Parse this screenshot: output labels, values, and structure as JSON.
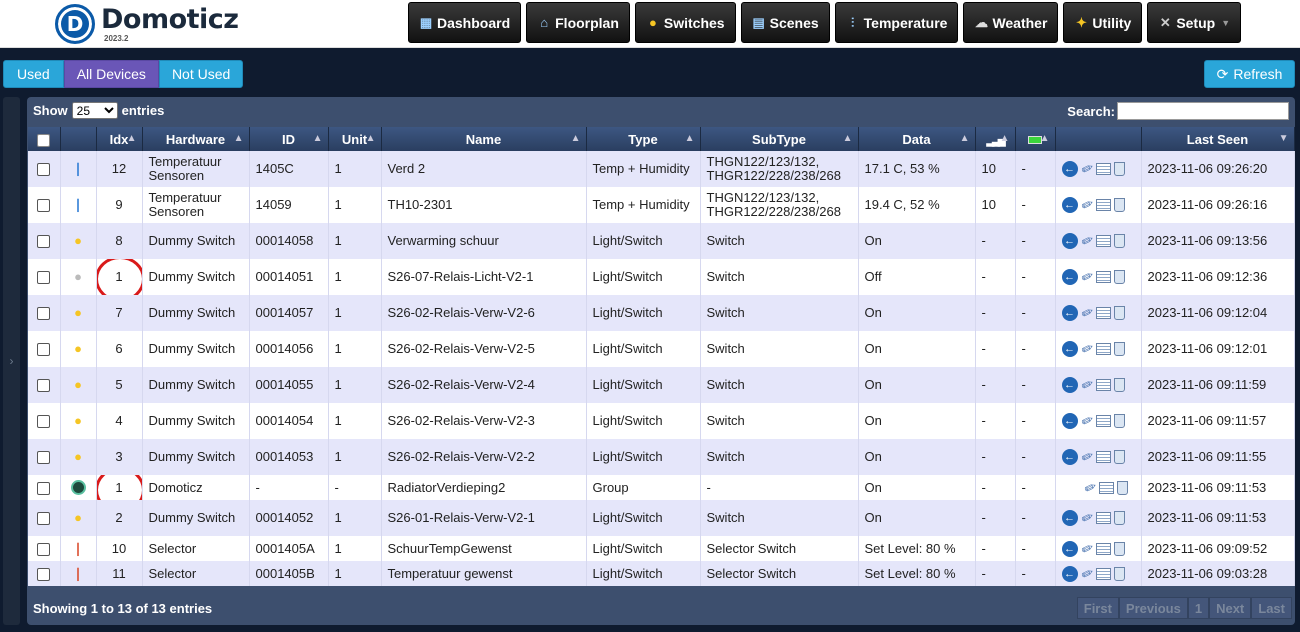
{
  "app": {
    "name": "Domoticz",
    "version": "2023.2"
  },
  "nav": [
    {
      "label": "Dashboard",
      "icon": "dashboard-icon"
    },
    {
      "label": "Floorplan",
      "icon": "floorplan-icon"
    },
    {
      "label": "Switches",
      "icon": "bulb-icon"
    },
    {
      "label": "Scenes",
      "icon": "scenes-icon"
    },
    {
      "label": "Temperature",
      "icon": "thermometer-icon"
    },
    {
      "label": "Weather",
      "icon": "weather-icon"
    },
    {
      "label": "Utility",
      "icon": "utility-icon"
    },
    {
      "label": "Setup",
      "icon": "wrench-icon"
    }
  ],
  "filter": {
    "used": "Used",
    "all": "All Devices",
    "not_used": "Not Used",
    "active": "All Devices"
  },
  "refresh_label": "Refresh",
  "table_ctrl": {
    "show": "Show",
    "page_size": "25",
    "entries": "entries",
    "search": "Search:"
  },
  "columns": {
    "idx": "Idx",
    "hardware": "Hardware",
    "id": "ID",
    "unit": "Unit",
    "name": "Name",
    "type": "Type",
    "subtype": "SubType",
    "data": "Data",
    "last_seen": "Last Seen"
  },
  "rows": [
    {
      "icon": "thermometer",
      "idx": "12",
      "hardware": "Temperatuur Sensoren",
      "id": "1405C",
      "unit": "1",
      "name": "Verd 2",
      "type": "Temp + Humidity",
      "subtype": "THGN122/123/132, THGR122/228/238/268",
      "data": "17.1 C, 53 %",
      "signal": "10",
      "battery": "-",
      "last_seen": "2023-11-06 09:26:20"
    },
    {
      "icon": "thermometer",
      "idx": "9",
      "hardware": "Temperatuur Sensoren",
      "id": "14059",
      "unit": "1",
      "name": "TH10-2301",
      "type": "Temp + Humidity",
      "subtype": "THGN122/123/132, THGR122/228/238/268",
      "data": "19.4 C, 52 %",
      "signal": "10",
      "battery": "-",
      "last_seen": "2023-11-06 09:26:16"
    },
    {
      "icon": "bulb",
      "idx": "8",
      "hardware": "Dummy Switch",
      "id": "00014058",
      "unit": "1",
      "name": "Verwarming schuur",
      "type": "Light/Switch",
      "subtype": "Switch",
      "data": "On",
      "signal": "-",
      "battery": "-",
      "last_seen": "2023-11-06 09:13:56"
    },
    {
      "icon": "bulb-off",
      "idx": "1",
      "hardware": "Dummy Switch",
      "id": "00014051",
      "unit": "1",
      "name": "S26-07-Relais-Licht-V2-1",
      "type": "Light/Switch",
      "subtype": "Switch",
      "data": "Off",
      "signal": "-",
      "battery": "-",
      "last_seen": "2023-11-06 09:12:36"
    },
    {
      "icon": "bulb",
      "idx": "7",
      "hardware": "Dummy Switch",
      "id": "00014057",
      "unit": "1",
      "name": "S26-02-Relais-Verw-V2-6",
      "type": "Light/Switch",
      "subtype": "Switch",
      "data": "On",
      "signal": "-",
      "battery": "-",
      "last_seen": "2023-11-06 09:12:04"
    },
    {
      "icon": "bulb",
      "idx": "6",
      "hardware": "Dummy Switch",
      "id": "00014056",
      "unit": "1",
      "name": "S26-02-Relais-Verw-V2-5",
      "type": "Light/Switch",
      "subtype": "Switch",
      "data": "On",
      "signal": "-",
      "battery": "-",
      "last_seen": "2023-11-06 09:12:01"
    },
    {
      "icon": "bulb",
      "idx": "5",
      "hardware": "Dummy Switch",
      "id": "00014055",
      "unit": "1",
      "name": "S26-02-Relais-Verw-V2-4",
      "type": "Light/Switch",
      "subtype": "Switch",
      "data": "On",
      "signal": "-",
      "battery": "-",
      "last_seen": "2023-11-06 09:11:59"
    },
    {
      "icon": "bulb",
      "idx": "4",
      "hardware": "Dummy Switch",
      "id": "00014054",
      "unit": "1",
      "name": "S26-02-Relais-Verw-V2-3",
      "type": "Light/Switch",
      "subtype": "Switch",
      "data": "On",
      "signal": "-",
      "battery": "-",
      "last_seen": "2023-11-06 09:11:57"
    },
    {
      "icon": "bulb",
      "idx": "3",
      "hardware": "Dummy Switch",
      "id": "00014053",
      "unit": "1",
      "name": "S26-02-Relais-Verw-V2-2",
      "type": "Light/Switch",
      "subtype": "Switch",
      "data": "On",
      "signal": "-",
      "battery": "-",
      "last_seen": "2023-11-06 09:11:55"
    },
    {
      "icon": "group",
      "idx": "1",
      "hardware": "Domoticz",
      "id": "-",
      "unit": "-",
      "name": "RadiatorVerdieping2",
      "type": "Group",
      "subtype": "-",
      "data": "On",
      "signal": "-",
      "battery": "-",
      "last_seen": "2023-11-06 09:11:53"
    },
    {
      "icon": "bulb",
      "idx": "2",
      "hardware": "Dummy Switch",
      "id": "00014052",
      "unit": "1",
      "name": "S26-01-Relais-Verw-V2-1",
      "type": "Light/Switch",
      "subtype": "Switch",
      "data": "On",
      "signal": "-",
      "battery": "-",
      "last_seen": "2023-11-06 09:11:53"
    },
    {
      "icon": "selector",
      "idx": "10",
      "hardware": "Selector",
      "id": "0001405A",
      "unit": "1",
      "name": "SchuurTempGewenst",
      "type": "Light/Switch",
      "subtype": "Selector Switch",
      "data": "Set Level: 80 %",
      "signal": "-",
      "battery": "-",
      "last_seen": "2023-11-06 09:09:52"
    },
    {
      "icon": "selector",
      "idx": "11",
      "hardware": "Selector",
      "id": "0001405B",
      "unit": "1",
      "name": "Temperatuur gewenst",
      "type": "Light/Switch",
      "subtype": "Selector Switch",
      "data": "Set Level: 80 %",
      "signal": "-",
      "battery": "-",
      "last_seen": "2023-11-06 09:03:28"
    }
  ],
  "footer": {
    "info": "Showing 1 to 13 of 13 entries",
    "first": "First",
    "previous": "Previous",
    "page": "1",
    "next": "Next",
    "last": "Last"
  }
}
